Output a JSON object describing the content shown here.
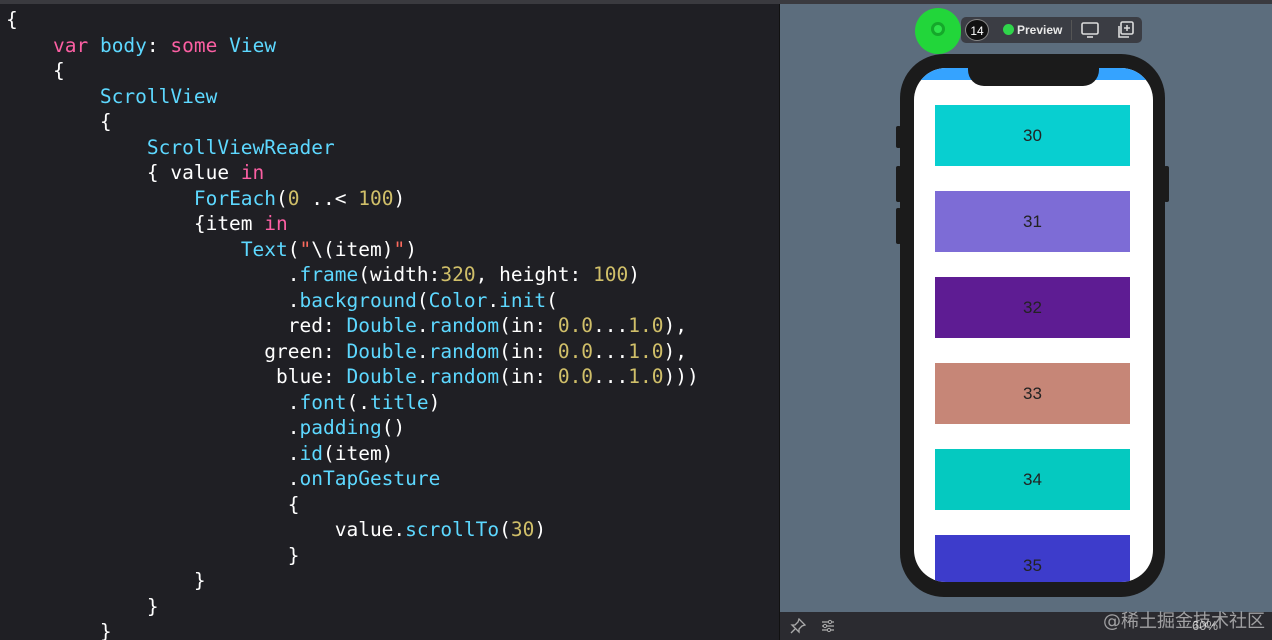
{
  "editor": {
    "lines": [
      [
        {
          "t": "{",
          "c": "pl"
        }
      ],
      [
        {
          "t": "    "
        },
        {
          "t": "var",
          "c": "kw"
        },
        {
          "t": " "
        },
        {
          "t": "body",
          "c": "ty"
        },
        {
          "t": ": ",
          "c": "pl"
        },
        {
          "t": "some",
          "c": "kw"
        },
        {
          "t": " "
        },
        {
          "t": "View",
          "c": "ty"
        }
      ],
      [
        {
          "t": "    {",
          "c": "pl"
        }
      ],
      [
        {
          "t": "        "
        },
        {
          "t": "ScrollView",
          "c": "ty"
        }
      ],
      [
        {
          "t": "        {",
          "c": "pl"
        }
      ],
      [
        {
          "t": "            "
        },
        {
          "t": "ScrollViewReader",
          "c": "ty"
        }
      ],
      [
        {
          "t": "            { value ",
          "c": "pl"
        },
        {
          "t": "in",
          "c": "kw"
        }
      ],
      [
        {
          "t": "                "
        },
        {
          "t": "ForEach",
          "c": "ty"
        },
        {
          "t": "(",
          "c": "pl"
        },
        {
          "t": "0",
          "c": "nm"
        },
        {
          "t": " ..< ",
          "c": "pl"
        },
        {
          "t": "100",
          "c": "nm"
        },
        {
          "t": ")",
          "c": "pl"
        }
      ],
      [
        {
          "t": "                {item ",
          "c": "pl"
        },
        {
          "t": "in",
          "c": "kw"
        }
      ],
      [
        {
          "t": "                    "
        },
        {
          "t": "Text",
          "c": "ty"
        },
        {
          "t": "(",
          "c": "pl"
        },
        {
          "t": "\"",
          "c": "st"
        },
        {
          "t": "\\(item)",
          "c": "pl"
        },
        {
          "t": "\"",
          "c": "st"
        },
        {
          "t": ")",
          "c": "pl"
        }
      ],
      [
        {
          "t": "                        ."
        },
        {
          "t": "frame",
          "c": "ty"
        },
        {
          "t": "(width:",
          "c": "pl"
        },
        {
          "t": "320",
          "c": "nm"
        },
        {
          "t": ", height: ",
          "c": "pl"
        },
        {
          "t": "100",
          "c": "nm"
        },
        {
          "t": ")",
          "c": "pl"
        }
      ],
      [
        {
          "t": "                        ."
        },
        {
          "t": "background",
          "c": "ty"
        },
        {
          "t": "(",
          "c": "pl"
        },
        {
          "t": "Color",
          "c": "ty"
        },
        {
          "t": ".",
          "c": "pl"
        },
        {
          "t": "init",
          "c": "ty"
        },
        {
          "t": "(",
          "c": "pl"
        }
      ],
      [
        {
          "t": "                        red: ",
          "c": "pl"
        },
        {
          "t": "Double",
          "c": "ty"
        },
        {
          "t": ".",
          "c": "pl"
        },
        {
          "t": "random",
          "c": "ty"
        },
        {
          "t": "(in: ",
          "c": "pl"
        },
        {
          "t": "0.0",
          "c": "nm"
        },
        {
          "t": "...",
          "c": "pl"
        },
        {
          "t": "1.0",
          "c": "nm"
        },
        {
          "t": "),",
          "c": "pl"
        }
      ],
      [
        {
          "t": "                      green: ",
          "c": "pl"
        },
        {
          "t": "Double",
          "c": "ty"
        },
        {
          "t": ".",
          "c": "pl"
        },
        {
          "t": "random",
          "c": "ty"
        },
        {
          "t": "(in: ",
          "c": "pl"
        },
        {
          "t": "0.0",
          "c": "nm"
        },
        {
          "t": "...",
          "c": "pl"
        },
        {
          "t": "1.0",
          "c": "nm"
        },
        {
          "t": "),",
          "c": "pl"
        }
      ],
      [
        {
          "t": "                       blue: ",
          "c": "pl"
        },
        {
          "t": "Double",
          "c": "ty"
        },
        {
          "t": ".",
          "c": "pl"
        },
        {
          "t": "random",
          "c": "ty"
        },
        {
          "t": "(in: ",
          "c": "pl"
        },
        {
          "t": "0.0",
          "c": "nm"
        },
        {
          "t": "...",
          "c": "pl"
        },
        {
          "t": "1.0",
          "c": "nm"
        },
        {
          "t": ")))",
          "c": "pl"
        }
      ],
      [
        {
          "t": "                        ."
        },
        {
          "t": "font",
          "c": "ty"
        },
        {
          "t": "(.",
          "c": "pl"
        },
        {
          "t": "title",
          "c": "ty"
        },
        {
          "t": ")",
          "c": "pl"
        }
      ],
      [
        {
          "t": "                        ."
        },
        {
          "t": "padding",
          "c": "ty"
        },
        {
          "t": "()",
          "c": "pl"
        }
      ],
      [
        {
          "t": "                        ."
        },
        {
          "t": "id",
          "c": "ty"
        },
        {
          "t": "(item)",
          "c": "pl"
        }
      ],
      [
        {
          "t": "                        ."
        },
        {
          "t": "onTapGesture",
          "c": "ty"
        }
      ],
      [
        {
          "t": "                        {",
          "c": "pl"
        }
      ],
      [
        {
          "t": "                            value.",
          "c": "pl"
        },
        {
          "t": "scrollTo",
          "c": "ty"
        },
        {
          "t": "(",
          "c": "pl"
        },
        {
          "t": "30",
          "c": "nm"
        },
        {
          "t": ")",
          "c": "pl"
        }
      ],
      [
        {
          "t": "                        }",
          "c": "pl"
        }
      ],
      [
        {
          "t": "                }",
          "c": "pl"
        }
      ],
      [
        {
          "t": "            }",
          "c": "pl"
        }
      ],
      [
        {
          "t": "        }",
          "c": "pl"
        }
      ]
    ]
  },
  "canvas": {
    "toolbar": {
      "version_badge": "14",
      "preview_label": "Preview",
      "live_icon": "live-preview-icon",
      "device_icon": "device-settings-icon",
      "duplicate_icon": "duplicate-preview-icon"
    },
    "rows": [
      {
        "label": "30",
        "color": "#08cfd0"
      },
      {
        "label": "31",
        "color": "#7d6cd6"
      },
      {
        "label": "32",
        "color": "#5e1c93"
      },
      {
        "label": "33",
        "color": "#c68677"
      },
      {
        "label": "34",
        "color": "#05c9c0"
      },
      {
        "label": "35",
        "color": "#3d3ccb"
      }
    ],
    "top_strip_color": "#35a3ff",
    "bottombar": {
      "pin_icon": "pin-icon",
      "settings_icon": "sliders-icon",
      "zoom_label": "60%"
    }
  },
  "watermark": "@稀土掘金技术社区"
}
